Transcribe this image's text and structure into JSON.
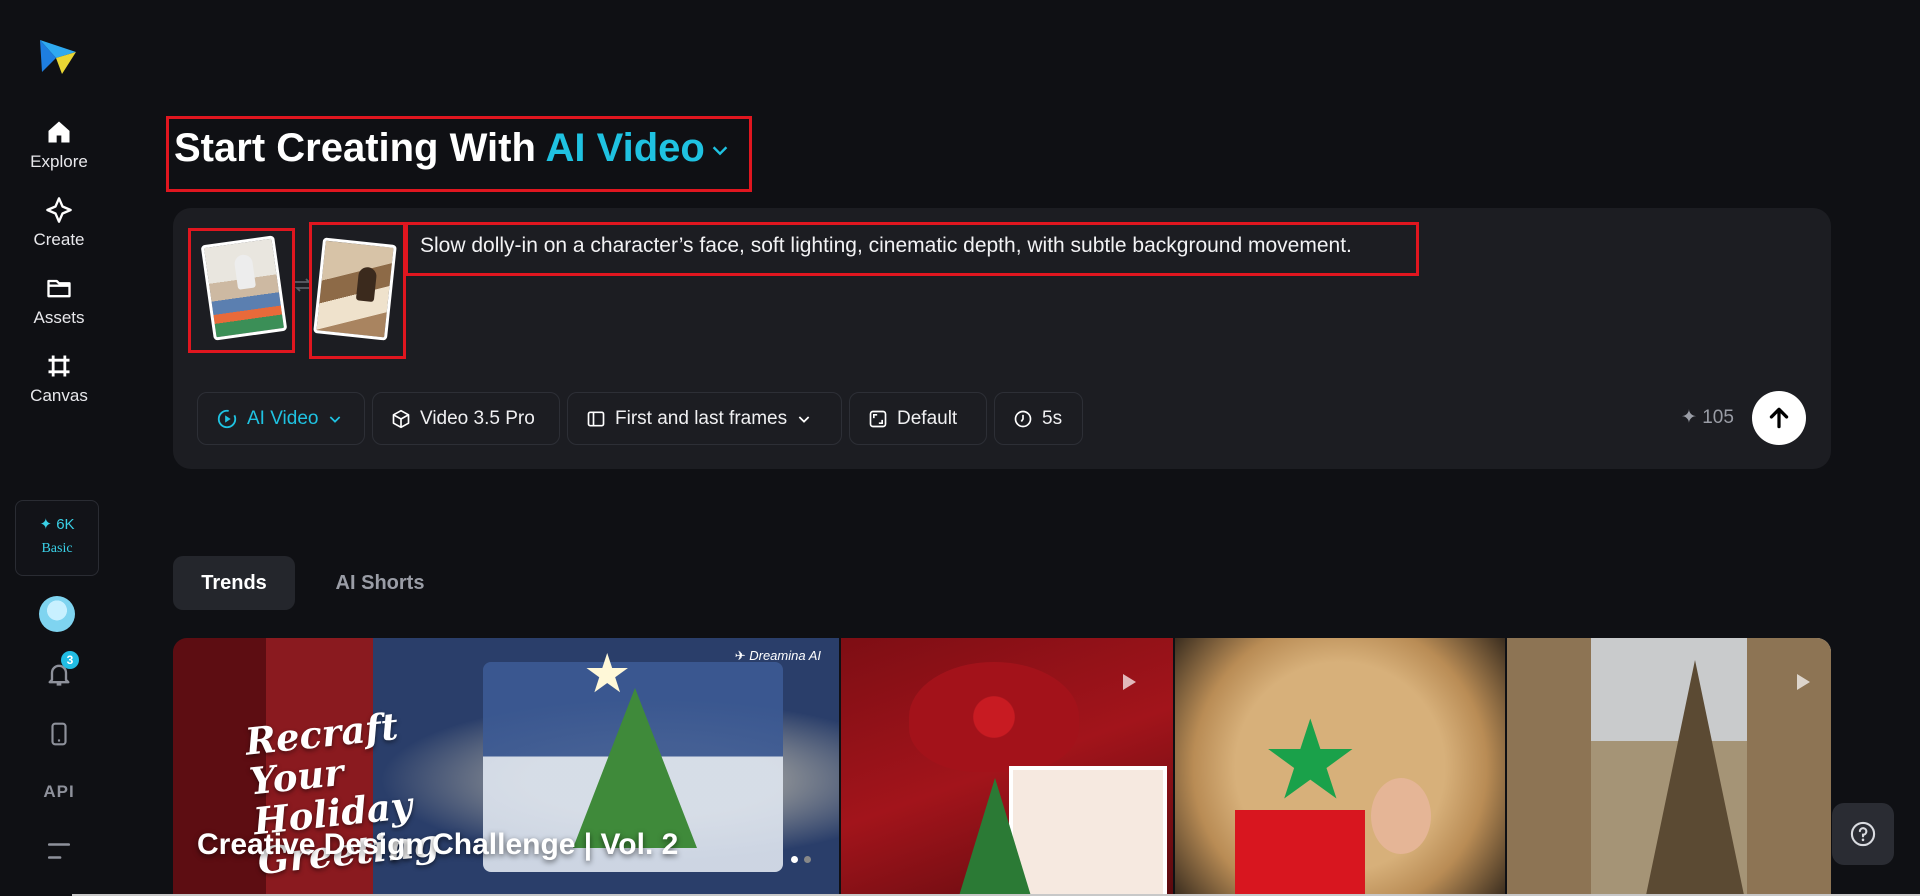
{
  "sidebar": {
    "items": [
      {
        "label": "Explore",
        "icon": "home-icon"
      },
      {
        "label": "Create",
        "icon": "sparkle-icon"
      },
      {
        "label": "Assets",
        "icon": "folder-icon"
      },
      {
        "label": "Canvas",
        "icon": "canvas-icon"
      }
    ],
    "credits": {
      "amount": "✦ 6K",
      "plan": "Basic"
    },
    "notifications_count": "3",
    "api_label": "API"
  },
  "heading": {
    "prefix": "Start Creating With",
    "mode": "AI Video"
  },
  "prompt": {
    "text": "Slow dolly-in on a character’s face, soft lighting, cinematic depth, with subtle background movement.",
    "toolbar": {
      "mode": "AI Video",
      "model": "Video 3.5 Pro",
      "frames": "First and last frames",
      "ratio": "Default",
      "duration": "5s",
      "credit_cost": "✦ 105"
    }
  },
  "tabs": [
    {
      "label": "Trends",
      "active": true
    },
    {
      "label": "AI Shorts",
      "active": false
    }
  ],
  "gallery": {
    "featured": {
      "title": "Creative Design Challenge | Vol. 2",
      "script_text": "Recraft Your Holiday Greeting",
      "brand": "✈ Dreamina AI"
    }
  },
  "colors": {
    "accent": "#1fc2e1",
    "highlight": "#e0161f",
    "background": "#0f1014",
    "panel": "#1c1d22"
  }
}
